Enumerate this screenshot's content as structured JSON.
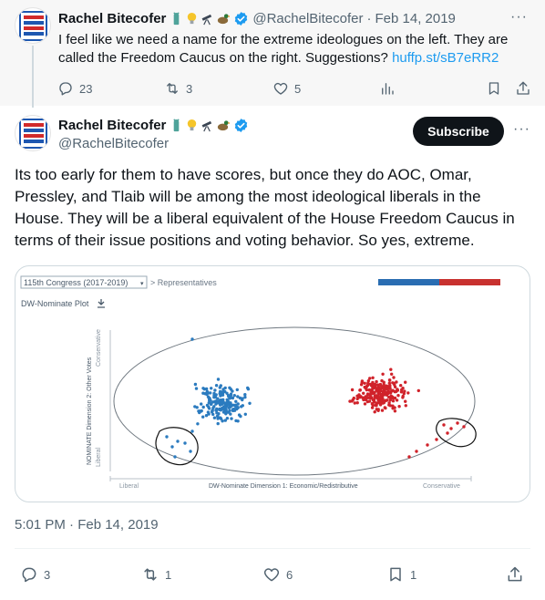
{
  "quoted_tweet": {
    "author_name": "Rachel Bitecofer",
    "handle": "@RachelBitecofer",
    "date": "Feb 14, 2019",
    "separator": "·",
    "text": "I feel like we need a name for the extreme ideologues on the left. They are called the Freedom Caucus on the right. Suggestions?",
    "link": "huffp.st/sB7eRR2",
    "replies": "23",
    "retweets": "3",
    "likes": "5",
    "more_label": "···"
  },
  "main_tweet": {
    "author_name": "Rachel Bitecofer",
    "handle": "@RachelBitecofer",
    "subscribe_label": "Subscribe",
    "more_label": "···",
    "text": "Its too early for them to have scores, but once they do AOC, Omar, Pressley, and Tlaib will be among the most ideological liberals in the House. They will be a liberal equivalent of the House Freedom Caucus in terms of their issue positions and voting behavior. So yes, extreme.",
    "timestamp": "5:01 PM · Feb 14, 2019",
    "replies": "3",
    "retweets": "1",
    "likes": "6",
    "bookmarks": "1"
  },
  "media": {
    "congress_select": "115th Congress (2017-2019)",
    "breadcrumb": "> Representatives",
    "plot_title": "DW-Nominate Plot",
    "y_axis_label": "NOMINATE Dimension 2: Other Votes",
    "y_axis_top": "Conservative",
    "y_axis_bottom": "Liberal",
    "x_axis_label": "DW-Nominate Dimension 1: Economic/Redistributive",
    "x_axis_left": "Liberal",
    "x_axis_right": "Conservative"
  },
  "colors": {
    "democrat_dot": "#2b7bbf",
    "republican_dot": "#d0222a",
    "legend_blue": "#2a6db2",
    "legend_red": "#c8312f",
    "link": "#1d9bf0",
    "subscribe_bg": "#0f1419"
  },
  "icons": [
    "verified-badge-icon",
    "reply-icon",
    "retweet-icon",
    "like-icon",
    "views-icon",
    "bookmark-icon",
    "share-icon",
    "download-icon"
  ]
}
